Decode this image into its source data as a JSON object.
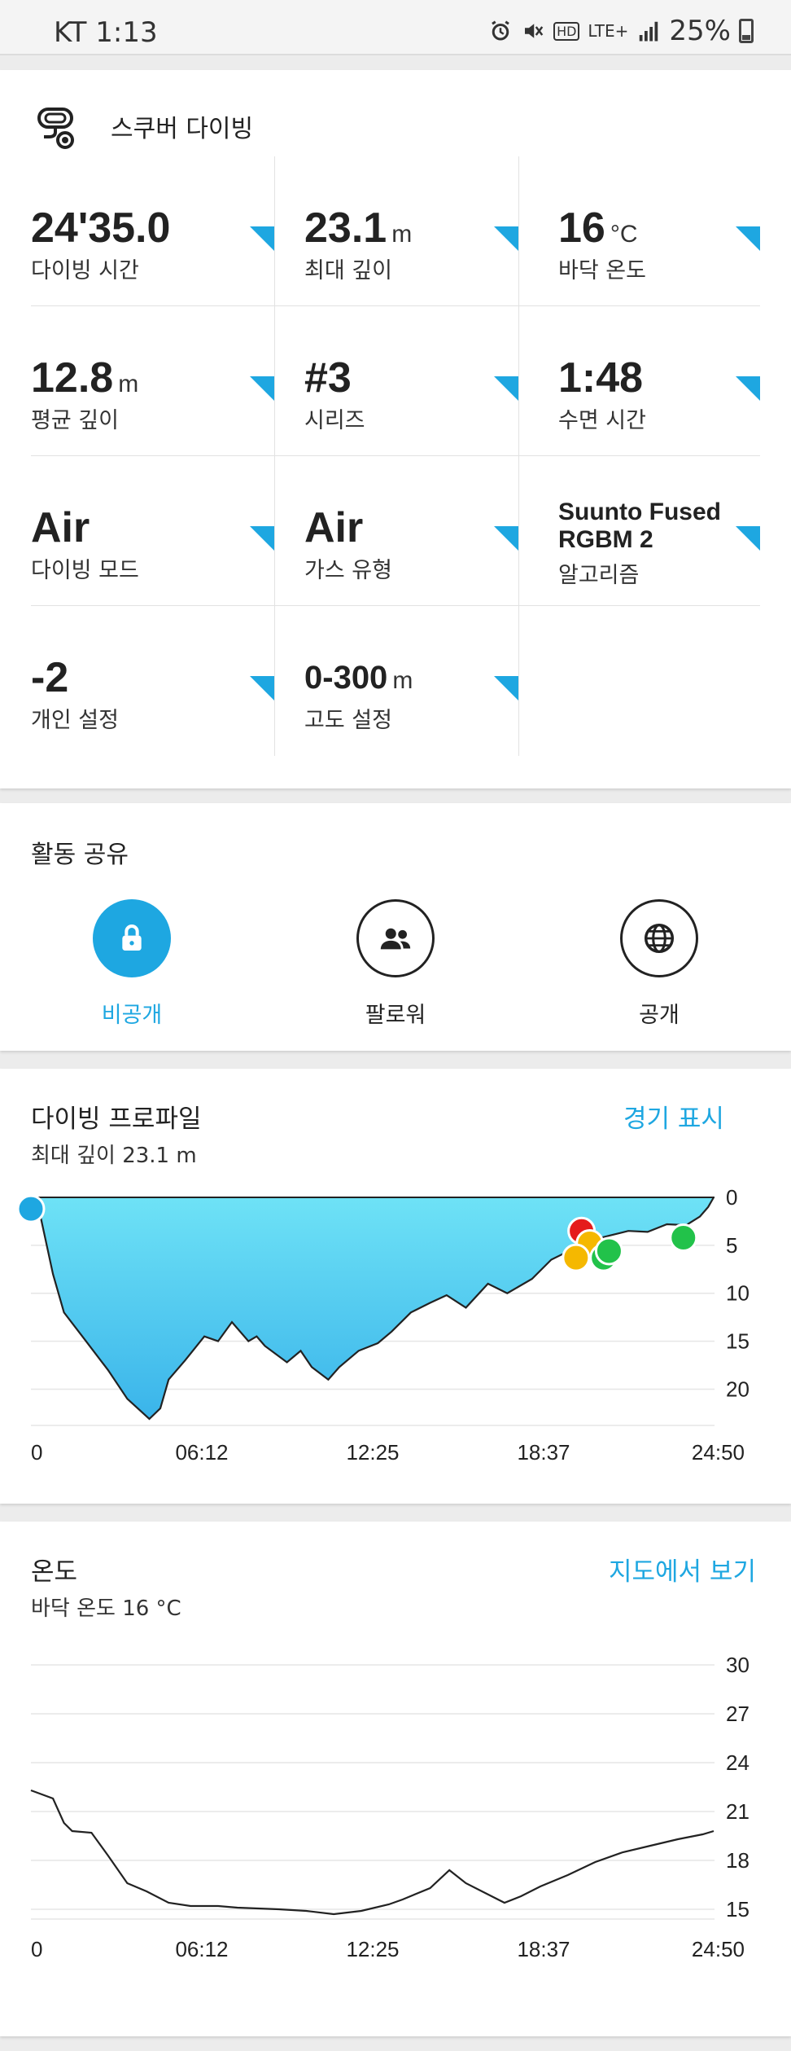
{
  "status_bar": {
    "carrier": "KT 1:13",
    "signal": "LTE+",
    "hd": "HD",
    "battery": "25%"
  },
  "summary": {
    "title": "스쿠버 다이빙",
    "stats": [
      {
        "value": "24'35.0",
        "unit": "",
        "label": "다이빙 시간"
      },
      {
        "value": "23.1",
        "unit": "m",
        "label": "최대 깊이"
      },
      {
        "value": "16",
        "unit": "°C",
        "label": "바닥 온도"
      },
      {
        "value": "12.8",
        "unit": "m",
        "label": "평균 깊이"
      },
      {
        "value": "#3",
        "unit": "",
        "label": "시리즈"
      },
      {
        "value": "1:48",
        "unit": "",
        "label": "수면 시간"
      },
      {
        "value": "Air",
        "unit": "",
        "label": "다이빙 모드"
      },
      {
        "value": "Air",
        "unit": "",
        "label": "가스 유형"
      },
      {
        "value": "Suunto Fused RGBM 2",
        "unit": "",
        "label": "알고리즘"
      },
      {
        "value": "-2",
        "unit": "",
        "label": "개인 설정"
      },
      {
        "value": "0-300",
        "unit": "m",
        "label": "고도 설정"
      }
    ]
  },
  "share": {
    "title": "활동 공유",
    "options": [
      {
        "label": "비공개",
        "icon": "lock-icon",
        "active": true
      },
      {
        "label": "팔로워",
        "icon": "followers-icon",
        "active": false
      },
      {
        "label": "공개",
        "icon": "globe-icon",
        "active": false
      }
    ]
  },
  "colors": {
    "accent": "#1ea7e1",
    "red": "#e51b1b",
    "yellow": "#f5b800",
    "green": "#22c24a"
  },
  "profile": {
    "title": "다이빙 프로파일",
    "link": "경기 표시",
    "subtitle": "최대 깊이 23.1 m",
    "chart_data": {
      "type": "area",
      "x_ticks": [
        "0",
        "06:12",
        "12:25",
        "18:37",
        "24:50"
      ],
      "y_ticks": [
        "0",
        "5",
        "10",
        "15",
        "20"
      ],
      "ylim": [
        0,
        23.1
      ],
      "y_inverted": true,
      "xlim_min": [
        0,
        24.83
      ],
      "series": [
        {
          "x": [
            0,
            0.35,
            0.8,
            1.2,
            2,
            2.8,
            3.5,
            4.3,
            4.7,
            5,
            5.6,
            6.3,
            6.8,
            7.3,
            7.9,
            8.2,
            8.5,
            9.3,
            9.8,
            10.2,
            10.8,
            11.2,
            11.9,
            12.6,
            13.1,
            13.8,
            14.5,
            15.1,
            15.8,
            16.6,
            17.3,
            18.2,
            18.9,
            19.6,
            20.3,
            21,
            21.7,
            22.4,
            23.1,
            23.8,
            24.3,
            24.6,
            24.8
          ],
          "y": [
            0,
            2,
            8,
            12,
            15,
            18,
            21,
            23.1,
            22,
            19,
            17,
            14.5,
            15,
            13,
            15,
            14.5,
            15.5,
            17.2,
            16,
            17.7,
            19,
            17.7,
            16,
            15.2,
            14,
            12,
            11,
            10.2,
            11.5,
            9,
            10,
            8.5,
            6.5,
            5.5,
            4.5,
            4,
            3.5,
            3.6,
            2.8,
            2.9,
            2,
            1,
            0
          ]
        }
      ],
      "events": [
        {
          "x": 0,
          "y": 1.2,
          "color": "blue"
        },
        {
          "x": 20,
          "y": 3.5,
          "color": "red"
        },
        {
          "x": 20.3,
          "y": 4.8,
          "color": "yellow"
        },
        {
          "x": 19.8,
          "y": 6.3,
          "color": "yellow"
        },
        {
          "x": 20.8,
          "y": 6.3,
          "color": "green"
        },
        {
          "x": 21,
          "y": 5.6,
          "color": "green"
        },
        {
          "x": 23.7,
          "y": 4.2,
          "color": "green"
        }
      ]
    }
  },
  "temperature": {
    "title": "온도",
    "link": "지도에서 보기",
    "subtitle": "바닥 온도 16 °C",
    "chart_data": {
      "type": "line",
      "x_ticks": [
        "0",
        "06:12",
        "12:25",
        "18:37",
        "24:50"
      ],
      "y_ticks": [
        "30",
        "27",
        "24",
        "21",
        "18",
        "15"
      ],
      "ylim": [
        14,
        30
      ],
      "xlim_min": [
        0,
        24.83
      ],
      "series": [
        {
          "x": [
            0,
            0.8,
            1.2,
            1.5,
            2.2,
            2.8,
            3.5,
            4.2,
            5,
            5.8,
            6.8,
            7.5,
            9,
            10,
            11,
            12,
            13,
            13.5,
            14.5,
            15.2,
            15.8,
            16.5,
            17.2,
            17.8,
            18.5,
            19.5,
            20.5,
            21.5,
            22.5,
            23.5,
            24.4,
            24.8
          ],
          "y": [
            22.3,
            21.8,
            20.3,
            19.8,
            19.7,
            18.3,
            16.6,
            16.1,
            15.4,
            15.2,
            15.2,
            15.1,
            15,
            14.9,
            14.7,
            14.9,
            15.3,
            15.6,
            16.3,
            17.4,
            16.6,
            16,
            15.4,
            15.8,
            16.4,
            17.1,
            17.9,
            18.5,
            18.9,
            19.3,
            19.6,
            19.8
          ]
        }
      ]
    }
  }
}
